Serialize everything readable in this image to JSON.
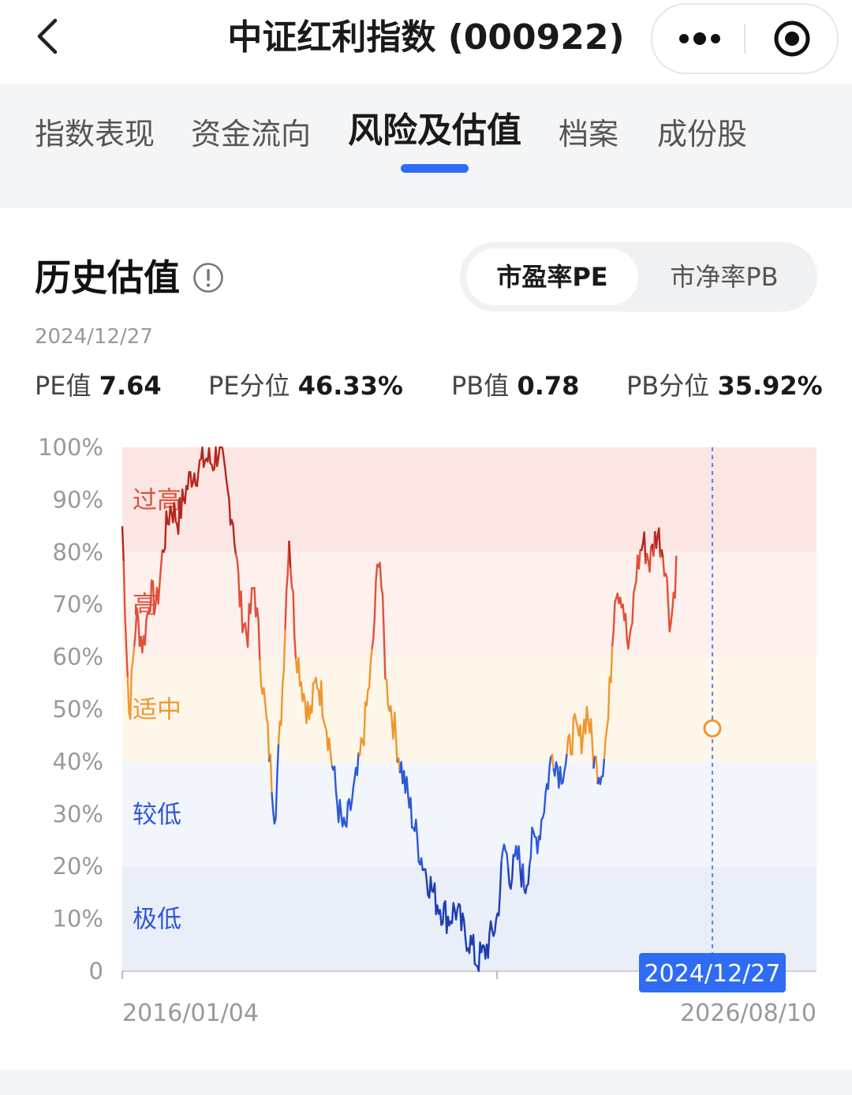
{
  "header": {
    "title": "中证红利指数 (000922)",
    "icons": {
      "back": "chevron-left-icon",
      "more": "more-dots-icon",
      "record": "record-circle-icon"
    }
  },
  "tabs": [
    {
      "label": "指数表现",
      "active": false
    },
    {
      "label": "资金流向",
      "active": false
    },
    {
      "label": "风险及估值",
      "active": true
    },
    {
      "label": "档案",
      "active": false
    },
    {
      "label": "成份股",
      "active": false
    }
  ],
  "section": {
    "title": "历史估值",
    "toggle": {
      "pe": "市盈率PE",
      "pb": "市净率PB",
      "selected": "pe"
    },
    "date": "2024/12/27"
  },
  "stats": [
    {
      "label": "PE值",
      "value": "7.64"
    },
    {
      "label": "PE分位",
      "value": "46.33%"
    },
    {
      "label": "PB值",
      "value": "0.78"
    },
    {
      "label": "PB分位",
      "value": "35.92%"
    }
  ],
  "colors": {
    "accent": "#2f6bf3",
    "very_high": "#b5261e",
    "high": "#e0503a",
    "mid": "#f0962e",
    "low": "#2e58d8",
    "very_low": "#1f3fb0",
    "band_very_high": "#fbe6e4",
    "band_high": "#fdf0ed",
    "band_mid": "#fff6ea",
    "band_low": "#f2f5fc",
    "band_very_low": "#e9eef9"
  },
  "chart_data": {
    "type": "line",
    "title": "",
    "ylabel": "",
    "xlabel": "",
    "ylim": [
      0,
      100
    ],
    "y_tick_labels": [
      "0",
      "10%",
      "20%",
      "30%",
      "40%",
      "50%",
      "60%",
      "70%",
      "80%",
      "90%",
      "100%"
    ],
    "x_tick_labels": [
      "2016/01/04",
      "2026/08/10"
    ],
    "bands": [
      {
        "label": "极低",
        "from": 0,
        "to": 20
      },
      {
        "label": "较低",
        "from": 20,
        "to": 40
      },
      {
        "label": "适中",
        "from": 40,
        "to": 60
      },
      {
        "label": "高",
        "from": 60,
        "to": 80
      },
      {
        "label": "过高",
        "from": 80,
        "to": 100
      }
    ],
    "cursor": {
      "date": "2024/12/27",
      "value": 46.33,
      "x_fraction": 0.85
    },
    "series": [
      {
        "x_fraction": [
          0,
          0.01,
          0.02,
          0.03,
          0.04,
          0.05,
          0.06,
          0.07,
          0.08,
          0.09,
          0.1,
          0.11,
          0.12,
          0.13,
          0.14,
          0.15,
          0.16,
          0.17,
          0.18,
          0.19,
          0.2,
          0.21,
          0.22,
          0.23,
          0.24,
          0.25,
          0.26,
          0.27,
          0.28,
          0.29,
          0.3,
          0.31,
          0.32,
          0.33,
          0.34,
          0.35,
          0.36,
          0.37,
          0.38,
          0.39,
          0.4,
          0.41,
          0.42,
          0.43,
          0.44,
          0.45,
          0.46,
          0.47,
          0.48,
          0.49,
          0.5,
          0.51,
          0.52,
          0.53,
          0.54,
          0.55,
          0.56,
          0.57,
          0.58,
          0.59,
          0.6,
          0.61,
          0.62,
          0.63,
          0.64,
          0.65,
          0.66,
          0.67,
          0.68,
          0.69,
          0.7,
          0.71,
          0.72,
          0.73,
          0.74,
          0.75,
          0.76,
          0.77,
          0.78,
          0.79,
          0.8,
          0.81,
          0.82,
          0.83,
          0.84,
          0.85,
          0.86,
          0.87,
          0.88,
          0.89,
          0.9,
          0.91,
          0.92,
          0.93,
          0.94,
          0.95,
          0.96,
          0.97,
          0.98,
          0.99,
          1.0
        ],
        "values": [
          85,
          48,
          68,
          62,
          72,
          70,
          82,
          89,
          86,
          91,
          95,
          96,
          98,
          97,
          100,
          92,
          86,
          70,
          64,
          74,
          58,
          44,
          30,
          52,
          84,
          62,
          54,
          48,
          56,
          51,
          42,
          32,
          26,
          32,
          38,
          48,
          60,
          82,
          55,
          48,
          40,
          34,
          28,
          22,
          18,
          14,
          12,
          10,
          12,
          8,
          6,
          2,
          3,
          6,
          10,
          24,
          18,
          22,
          16,
          24,
          26,
          34,
          42,
          38,
          40,
          46,
          44,
          50,
          40,
          38,
          48,
          74,
          72,
          60,
          76,
          82,
          78,
          84,
          80,
          66,
          80
        ],
        "values_note": ""
      }
    ]
  }
}
